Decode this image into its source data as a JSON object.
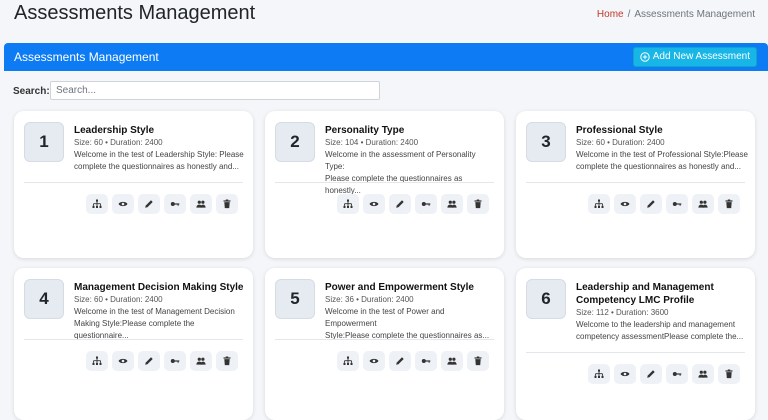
{
  "header": {
    "title": "Assessments Management",
    "breadcrumb_home": "Home",
    "breadcrumb_sep": "/",
    "breadcrumb_current": "Assessments Management"
  },
  "panel": {
    "title": "Assessments Management",
    "add_button_label": "Add New Assessment"
  },
  "search": {
    "label": "Search:",
    "placeholder": "Search..."
  },
  "cards": [
    {
      "number": "1",
      "title": "Leadership Style",
      "meta": "Size: 60 • Duration: 2400",
      "description_line1": "Welcome in the test of Leadership Style: Please",
      "description_line2": "complete the questionnaires as honestly and..."
    },
    {
      "number": "2",
      "title": "Personality Type",
      "meta": "Size: 104 • Duration: 2400",
      "description_line1": "Welcome in the assessment of Personality Type:",
      "description_line2": "Please complete the questionnaires as honestly..."
    },
    {
      "number": "3",
      "title": "Professional Style",
      "meta": "Size: 60 • Duration: 2400",
      "description_line1": "Welcome in the test of Professional Style:Please",
      "description_line2": "complete the questionnaires as honestly and..."
    },
    {
      "number": "4",
      "title": "Management Decision Making Style",
      "meta": "Size: 60 • Duration: 2400",
      "description_line1": "Welcome in the test of Management Decision",
      "description_line2": "Making Style:Please complete the questionnaire..."
    },
    {
      "number": "5",
      "title": "Power and Empowerment Style",
      "meta": "Size: 36 • Duration: 2400",
      "description_line1": "Welcome in the test of Power and Empowerment",
      "description_line2": "Style:Please complete the questionnaires as..."
    },
    {
      "number": "6",
      "title": "Leadership and Management Competency LMC Profile",
      "meta": "Size: 112 • Duration: 3600",
      "description_line1": "Welcome to the leadership and management",
      "description_line2": "competency assessmentPlease complete the..."
    }
  ],
  "action_icons": [
    "sitemap-icon",
    "eye-icon",
    "pencil-icon",
    "key-icon",
    "users-icon",
    "trash-icon"
  ],
  "colors": {
    "primary": "#0d7cf4",
    "info_button": "#17b6e6",
    "background": "#f4f6f9",
    "breadcrumb_link": "#c0392b"
  }
}
